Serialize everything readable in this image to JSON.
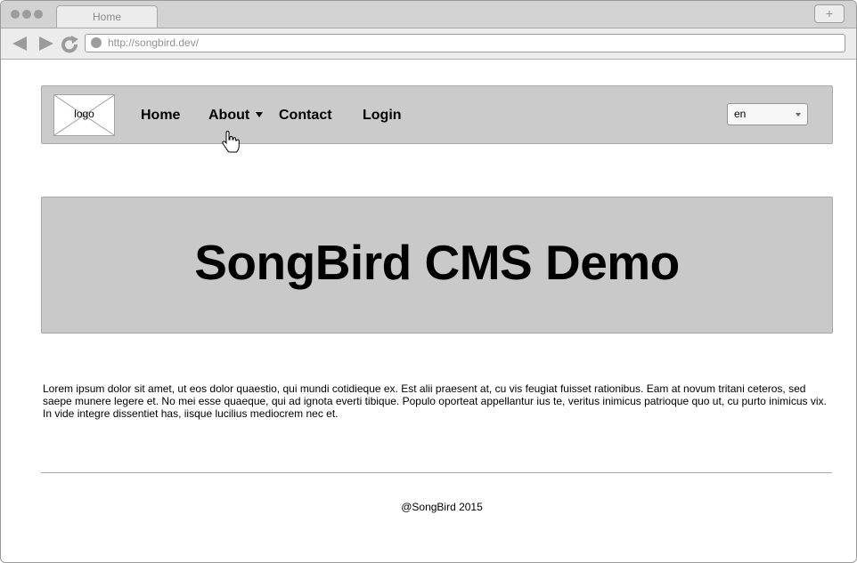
{
  "browser": {
    "tab_title": "Home",
    "new_tab_label": "+",
    "url": "http://songbird.dev/"
  },
  "site_nav": {
    "logo_label": "logo",
    "links": [
      "Home",
      "About",
      "Contact",
      "Login"
    ],
    "language": "en"
  },
  "hero": {
    "title": "SongBird CMS Demo"
  },
  "content": {
    "paragraph": "Lorem ipsum dolor sit amet, ut eos dolor quaestio, qui mundi cotidieque ex. Est alii praesent at, cu vis feugiat fuisset rationibus. Eam at novum tritani ceteros, sed saepe munere legere et. No mei esse quaeque, qui ad ignota everti tibique. Populo oporteat appellantur ius te, veritus inimicus patrioque quo ut, cu purto inimicus vix. In vide integre dissentiet has, iisque lucilius mediocrem nec et."
  },
  "footer": {
    "text": "@SongBird 2015"
  },
  "colors": {
    "chrome": "#d2d2d2",
    "panel": "#cbcbcb",
    "border": "#a9a9a9"
  },
  "icons": [
    "back-arrow-icon",
    "forward-arrow-icon",
    "reload-icon",
    "site-icon",
    "image-placeholder-icon",
    "hand-cursor-icon",
    "dropdown-caret-icon"
  ]
}
